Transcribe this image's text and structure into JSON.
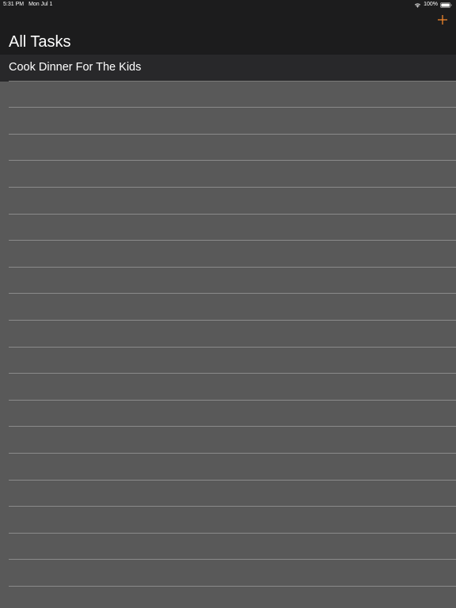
{
  "status_bar": {
    "time": "5:31 PM",
    "date": "Mon Jul 1",
    "battery": "100%",
    "wifi_icon": "wifi-icon",
    "battery_icon": "battery-icon"
  },
  "nav": {
    "title": "All Tasks",
    "add_icon": "plus-icon",
    "accent_color": "#f0862c"
  },
  "tasks": [
    {
      "title": "Cook Dinner For The Kids"
    }
  ],
  "colors": {
    "nav_background": "#1c1c1d",
    "list_background": "#595959",
    "row_background": "#28282a",
    "separator": "#8a8a8a",
    "text": "#ffffff"
  }
}
